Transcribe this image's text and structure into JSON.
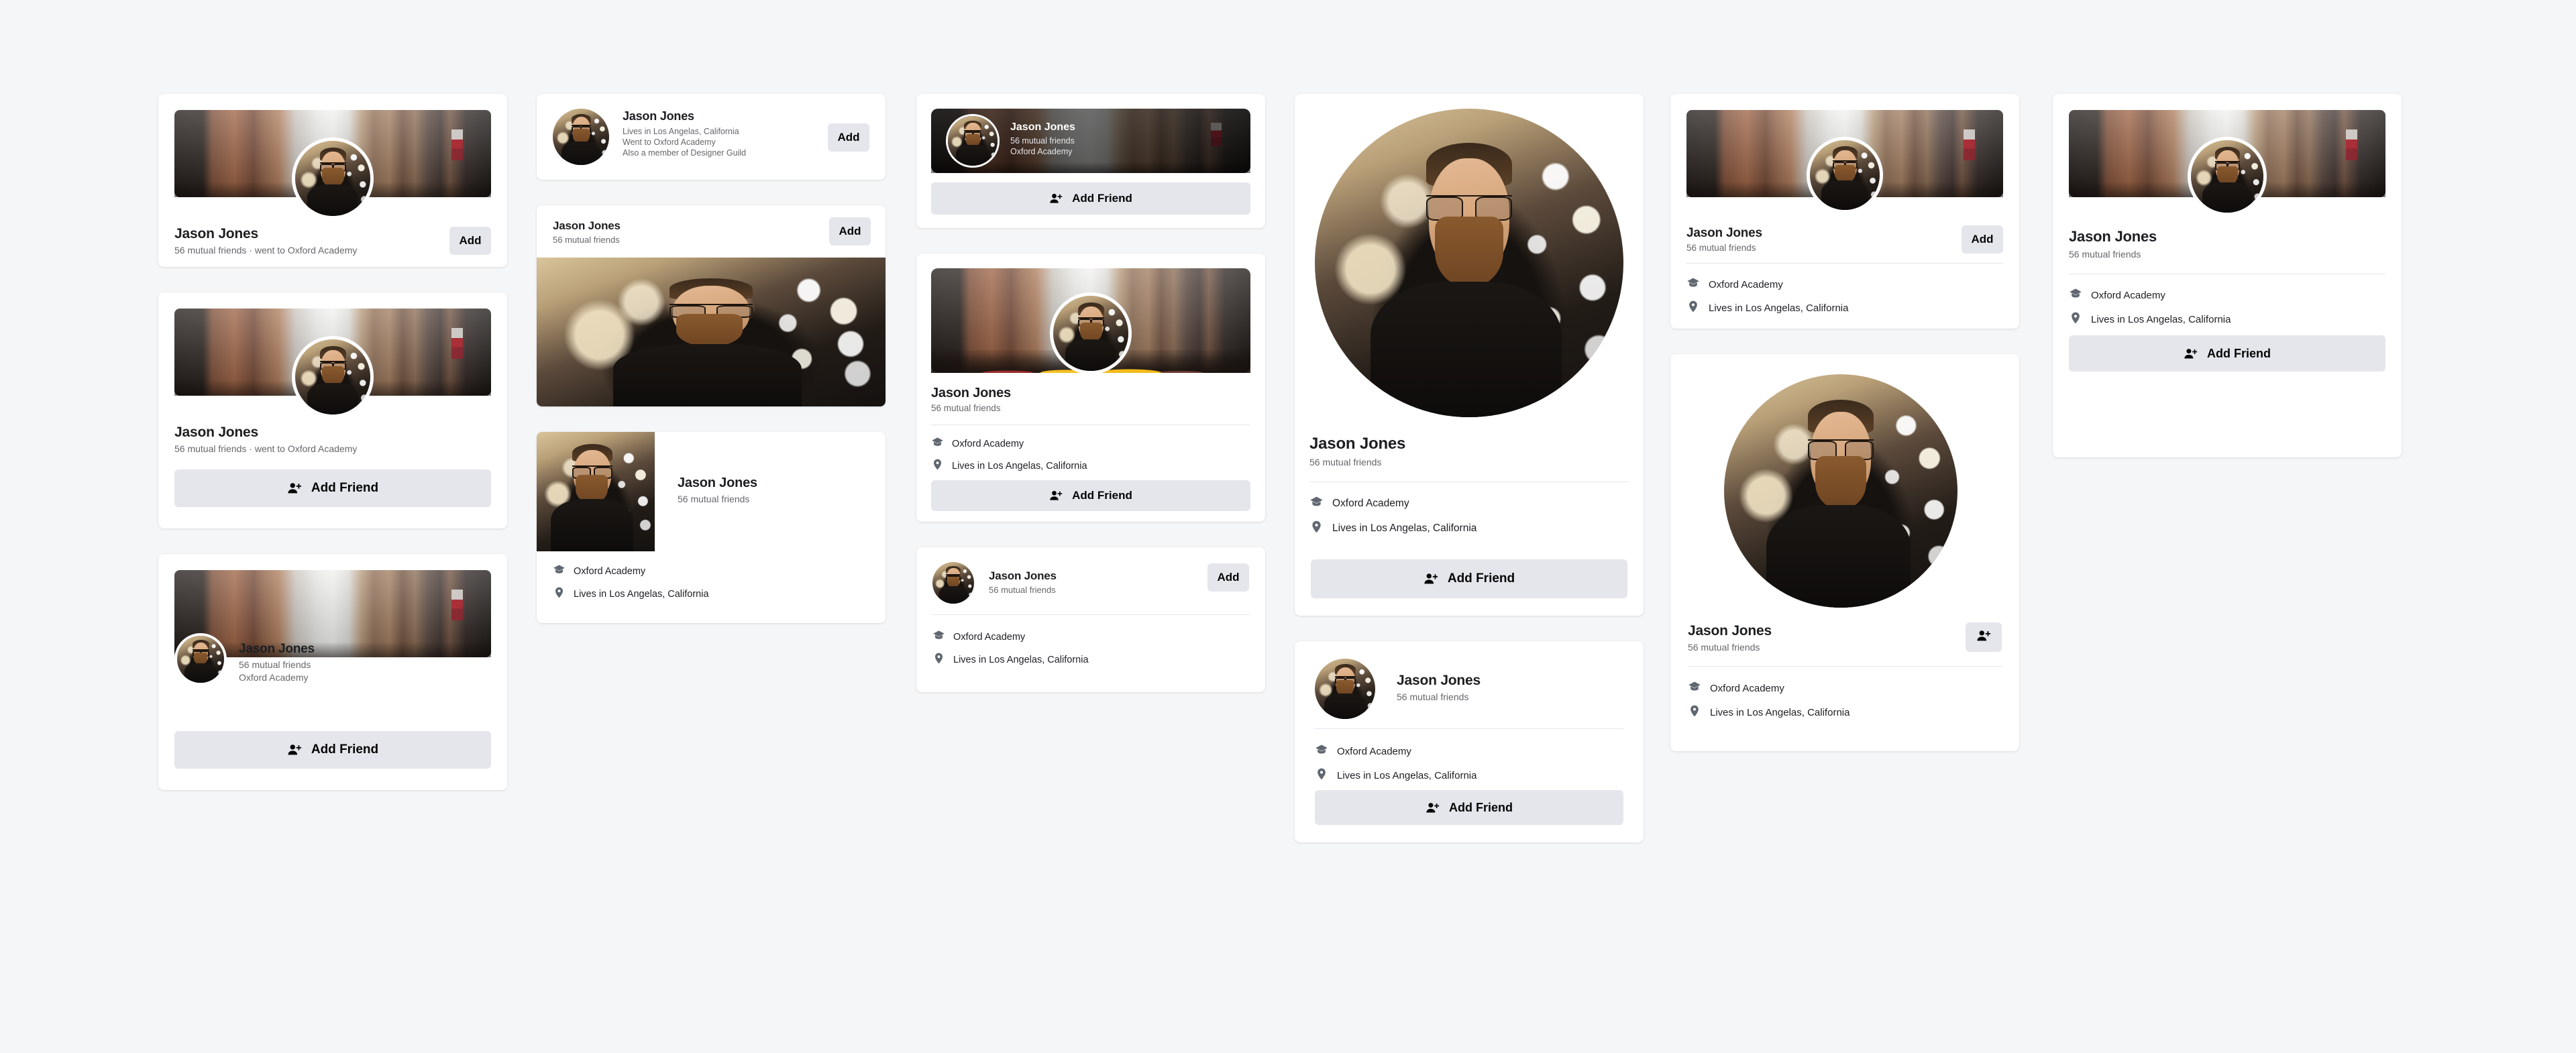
{
  "person": {
    "name": "Jason Jones",
    "mutual": "56 mutual friends",
    "school": "Oxford Academy",
    "location": "Lives in Los Angelas, California",
    "mutual_and_school": "56 mutual friends · went to Oxford Academy",
    "lives_line": "Lives in Los Angelas, California",
    "went_line": "Went to Oxford Academy",
    "guild_line": "Also a member of Designer Guild"
  },
  "labels": {
    "add": "Add",
    "add_friend": "Add Friend"
  },
  "icons": {
    "school": "graduation-cap-icon",
    "location": "map-pin-icon",
    "add_friend": "person-add-icon"
  },
  "colors": {
    "page_background": "#f4f6f8",
    "card_background": "#ffffff",
    "button_background": "#e4e6eb",
    "primary_text": "#1c1e21",
    "secondary_text": "#65676b",
    "divider": "#e4e6eb"
  },
  "cards": [
    {
      "id": "c1-banner-center-avatar-add",
      "name": "Jason Jones",
      "sub": "56 mutual friends · went to Oxford Academy"
    },
    {
      "id": "c2-banner-center-avatar-addfriend",
      "name": "Jason Jones",
      "sub": "56 mutual friends · went to Oxford Academy",
      "button": "Add Friend"
    },
    {
      "id": "c3-banner-left-avatar",
      "name": "Jason Jones",
      "sub": "56 mutual friends",
      "sub2": "Oxford Academy",
      "button": "Add Friend"
    },
    {
      "id": "c4-row-multiline",
      "name": "Jason Jones",
      "l1": "Lives in Los Angelas, California",
      "l2": "Went to Oxford Academy",
      "l3": "Also a member of Designer Guild",
      "button": "Add"
    },
    {
      "id": "c5-header-photo",
      "name": "Jason Jones",
      "sub": "56 mutual friends",
      "button": "Add"
    },
    {
      "id": "c6-thumb-left-details",
      "name": "Jason Jones",
      "sub": "56 mutual friends",
      "school": "Oxford Academy",
      "location": "Lives in Los Angelas, California"
    },
    {
      "id": "c7-dark-banner-overlay",
      "name": "Jason Jones",
      "sub": "56 mutual friends",
      "sub2": "Oxford Academy",
      "button": "Add Friend"
    },
    {
      "id": "c8-banner-avatar-details",
      "name": "Jason Jones",
      "sub": "56 mutual friends",
      "school": "Oxford Academy",
      "location": "Lives in Los Angelas, California",
      "button": "Add Friend"
    },
    {
      "id": "c9-avatar-row-details",
      "name": "Jason Jones",
      "sub": "56 mutual friends",
      "school": "Oxford Academy",
      "location": "Lives in Los Angelas, California",
      "button": "Add"
    },
    {
      "id": "c10-big-circle-avatar",
      "name": "Jason Jones",
      "sub": "56 mutual friends",
      "school": "Oxford Academy",
      "location": "Lives in Los Angelas, California",
      "button": "Add Friend"
    },
    {
      "id": "c11-avatar-row-addfriend",
      "name": "Jason Jones",
      "sub": "56 mutual friends",
      "school": "Oxford Academy",
      "location": "Lives in Los Angelas, California",
      "button": "Add Friend"
    },
    {
      "id": "c12-banner-avatar-add-details",
      "name": "Jason Jones",
      "sub": "56 mutual friends",
      "school": "Oxford Academy",
      "location": "Lives in Los Angelas, California",
      "button": "Add"
    },
    {
      "id": "c13-circle-avatar-icononly",
      "name": "Jason Jones",
      "sub": "56 mutual friends",
      "school": "Oxford Academy",
      "location": "Lives in Los Angelas, California"
    },
    {
      "id": "c14-banner-avatar-addfriend",
      "name": "Jason Jones",
      "sub": "56 mutual friends",
      "school": "Oxford Academy",
      "location": "Lives in Los Angelas, California",
      "button": "Add Friend"
    }
  ]
}
